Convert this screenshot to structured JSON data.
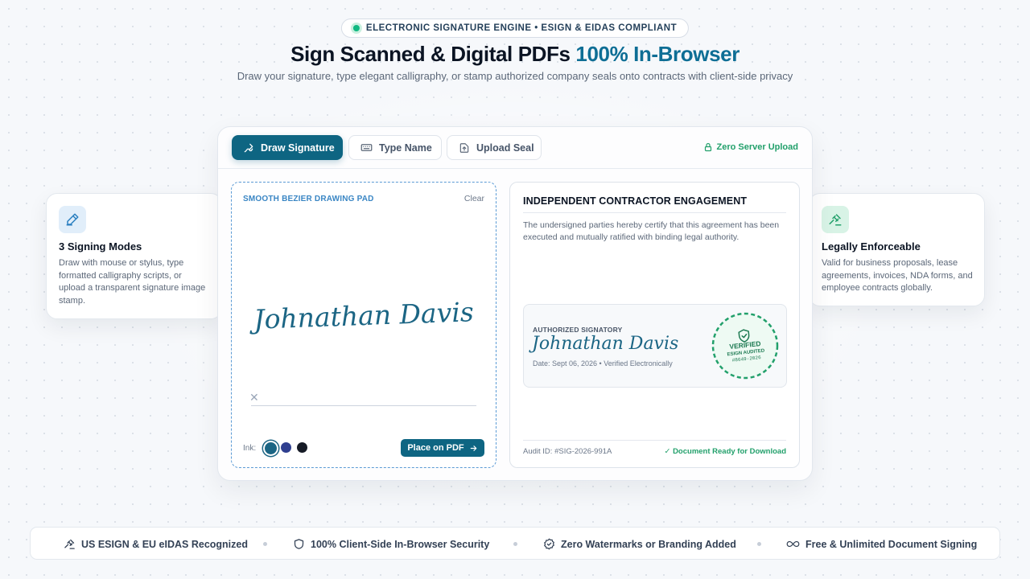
{
  "badge": {
    "text": "ELECTRONIC SIGNATURE ENGINE • ESIGN & EIDAS COMPLIANT",
    "dot_color": "#10b981"
  },
  "hero": {
    "title_main": "Sign Scanned & Digital PDFs ",
    "title_accent": "100% In-Browser",
    "accent_color": "#0e6e95"
  },
  "subtitle": "Draw your signature, type elegant calligraphy, or stamp authorized company seals onto contracts with client-side privacy",
  "tabs": [
    {
      "label": "Draw Signature",
      "icon": "pen-icon",
      "active": true
    },
    {
      "label": "Type Name",
      "icon": "keyboard-icon",
      "active": false
    },
    {
      "label": "Upload Seal",
      "icon": "upload-file-icon",
      "active": false
    }
  ],
  "zero_upload": {
    "label": "Zero Server Upload",
    "icon": "lock-icon",
    "color": "#22a06b"
  },
  "pad": {
    "title": "SMOOTH BEZIER DRAWING PAD",
    "clear_label": "Clear",
    "signature": "Johnathan Davis",
    "baseline_mark": "✕",
    "ink_label": "Ink:",
    "ink_colors": [
      "#1b6584",
      "#2f3f8f",
      "#161b26"
    ],
    "place_button": "Place on PDF"
  },
  "document": {
    "title": "INDEPENDENT CONTRACTOR ENGAGEMENT",
    "body": "The undersigned parties hereby certify that this agreement has been executed and mutually ratified with binding legal authority.",
    "signatory_label": "AUTHORIZED SIGNATORY",
    "signature": "Johnathan Davis",
    "meta": "Date: Sept 06, 2026 • Verified Electronically",
    "stamp": {
      "line1": "VERIFIED",
      "line2": "ESIGN AUDITED",
      "line3": "#8649-2026",
      "color": "#22a06b"
    },
    "audit_id": "Audit ID: #SIG-2026-991A",
    "ready": "✓ Document Ready for Download"
  },
  "features": {
    "left": {
      "icon": "pen-edit-icon",
      "title": "3 Signing Modes",
      "text": "Draw with mouse or stylus, type formatted calligraphy scripts, or upload a transparent signature image stamp."
    },
    "right": {
      "icon": "gavel-icon",
      "title": "Legally Enforceable",
      "text": "Valid for business proposals, lease agreements, invoices, NDA forms, and employee contracts globally."
    }
  },
  "footer_items": [
    {
      "icon": "gavel-icon",
      "label": "US ESIGN & EU eIDAS Recognized"
    },
    {
      "icon": "shield-icon",
      "label": "100% Client-Side In-Browser Security"
    },
    {
      "icon": "badge-check-icon",
      "label": "Zero Watermarks or Branding Added"
    },
    {
      "icon": "infinity-icon",
      "label": "Free & Unlimited Document Signing"
    }
  ]
}
